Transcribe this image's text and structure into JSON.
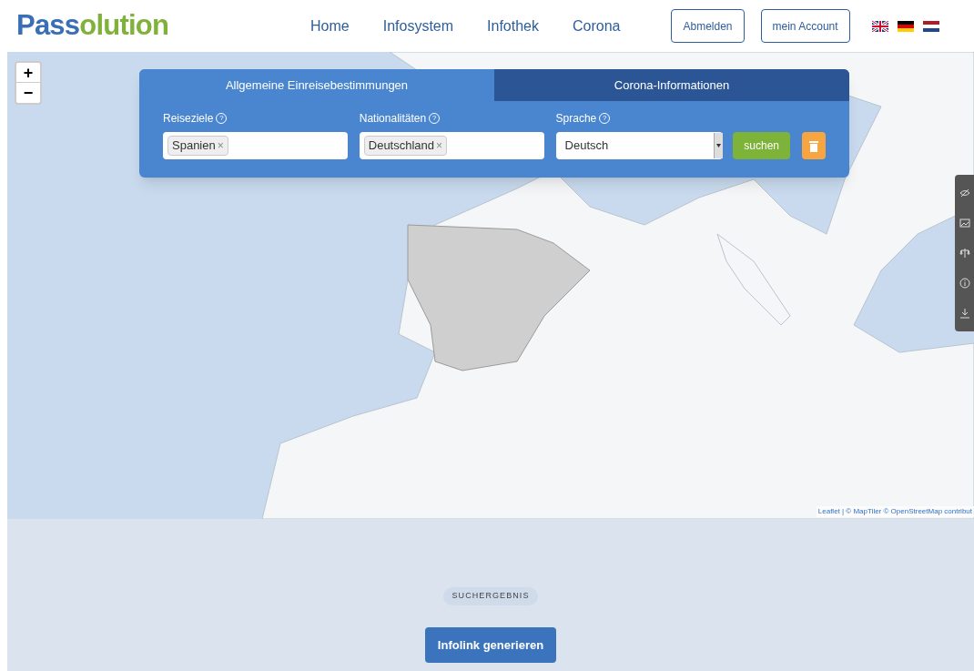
{
  "header": {
    "logo": {
      "part_1": "Pass",
      "part_2": "olution"
    },
    "nav": [
      "Home",
      "Infosystem",
      "Infothek",
      "Corona"
    ],
    "buttons": [
      "Abmelden",
      "mein Account"
    ],
    "flags": [
      {
        "kind": "uk"
      },
      {
        "kind": "de"
      },
      {
        "kind": "nl"
      }
    ]
  },
  "map": {
    "zoom": [
      "+",
      "−"
    ],
    "attribution": "Leaflet | © MapTiler © OpenStreetMap contribut",
    "tools": [
      {
        "kind": "eye-off"
      },
      {
        "kind": "image"
      },
      {
        "kind": "scale"
      },
      {
        "kind": "info"
      },
      {
        "kind": "download"
      }
    ]
  },
  "search_panel": {
    "tabs": [
      {
        "label": "Allgemeine Einreisebestimmungen",
        "selected": true
      },
      {
        "label": "Corona-Informationen",
        "selected": false
      }
    ],
    "fields": [
      {
        "kind": "tags",
        "label": "Reiseziele",
        "help": "?",
        "tags": [
          {
            "text": "Spanien",
            "remove": "×"
          }
        ]
      },
      {
        "kind": "tags",
        "label": "Nationalitäten",
        "help": "?",
        "tags": [
          {
            "text": "Deutschland",
            "remove": "×"
          }
        ]
      },
      {
        "kind": "select",
        "label": "Sprache",
        "help": "?",
        "value": "Deutsch"
      }
    ],
    "search_button": "suchen"
  },
  "results": {
    "badge": "SUCHERGEBNIS",
    "button": "Infolink generieren"
  }
}
